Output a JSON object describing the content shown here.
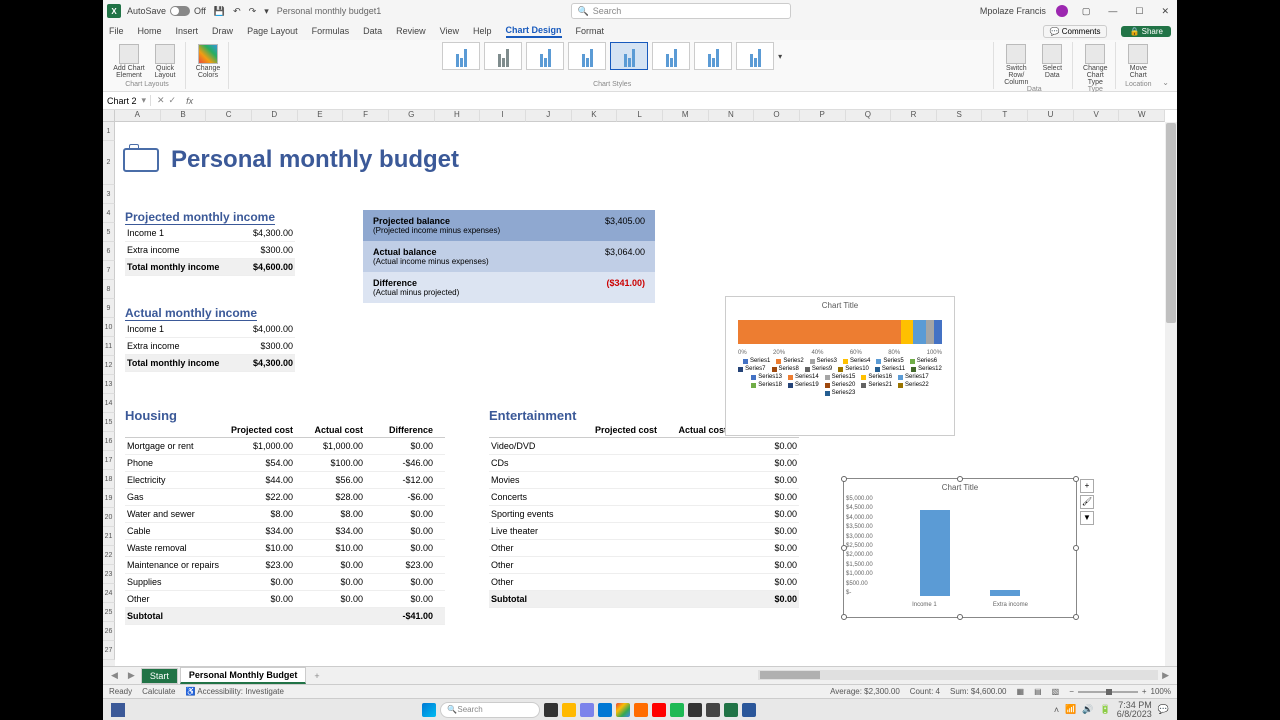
{
  "titlebar": {
    "autosave": "AutoSave",
    "autosave_state": "Off",
    "docname": "Personal monthly budget1",
    "search_placeholder": "Search",
    "username": "Mpolaze Francis"
  },
  "ribbon_tabs": [
    "File",
    "Home",
    "Insert",
    "Draw",
    "Page Layout",
    "Formulas",
    "Data",
    "Review",
    "View",
    "Help",
    "Chart Design",
    "Format"
  ],
  "ribbon_active": "Chart Design",
  "ribbon_right": {
    "comments": "Comments",
    "share": "Share"
  },
  "ribbon_groups": {
    "layouts": {
      "add_element": "Add Chart Element",
      "quick": "Quick Layout",
      "label": "Chart Layouts"
    },
    "colors": {
      "change": "Change Colors"
    },
    "styles_label": "Chart Styles",
    "data": {
      "switch": "Switch Row/ Column",
      "select": "Select Data",
      "label": "Data"
    },
    "type": {
      "change": "Change Chart Type",
      "label": "Type"
    },
    "location": {
      "move": "Move Chart",
      "label": "Location"
    }
  },
  "namebox": "Chart 2",
  "columns": [
    "A",
    "B",
    "C",
    "D",
    "E",
    "F",
    "G",
    "H",
    "I",
    "J",
    "K",
    "L",
    "M",
    "N",
    "O",
    "P",
    "Q",
    "R",
    "S",
    "T",
    "U",
    "V",
    "W"
  ],
  "rows": [
    "1",
    "2",
    "3",
    "4",
    "5",
    "6",
    "7",
    "8",
    "9",
    "10",
    "11",
    "12",
    "13",
    "14",
    "15",
    "16",
    "17",
    "18",
    "19",
    "20",
    "21",
    "22",
    "23",
    "24",
    "25",
    "26",
    "27"
  ],
  "doc": {
    "title": "Personal monthly budget",
    "proj_income_h": "Projected monthly income",
    "actual_income_h": "Actual monthly income",
    "income_rows": [
      {
        "label": "Income 1",
        "proj": "$4,300.00",
        "actual": "$4,000.00"
      },
      {
        "label": "Extra income",
        "proj": "$300.00",
        "actual": "$300.00"
      },
      {
        "label": "Total monthly income",
        "proj": "$4,600.00",
        "actual": "$4,300.00"
      }
    ],
    "balance": {
      "proj_label": "Projected balance",
      "proj_sub": "(Projected income minus expenses)",
      "proj_val": "$3,405.00",
      "actual_label": "Actual balance",
      "actual_sub": "(Actual income minus expenses)",
      "actual_val": "$3,064.00",
      "diff_label": "Difference",
      "diff_sub": "(Actual minus projected)",
      "diff_val": "($341.00)"
    },
    "housing_h": "Housing",
    "ent_h": "Entertainment",
    "col_headers": {
      "proj": "Projected cost",
      "actual": "Actual cost",
      "diff": "Difference"
    },
    "housing": [
      {
        "n": "Mortgage or rent",
        "p": "$1,000.00",
        "a": "$1,000.00",
        "d": "$0.00"
      },
      {
        "n": "Phone",
        "p": "$54.00",
        "a": "$100.00",
        "d": "-$46.00"
      },
      {
        "n": "Electricity",
        "p": "$44.00",
        "a": "$56.00",
        "d": "-$12.00"
      },
      {
        "n": "Gas",
        "p": "$22.00",
        "a": "$28.00",
        "d": "-$6.00"
      },
      {
        "n": "Water and sewer",
        "p": "$8.00",
        "a": "$8.00",
        "d": "$0.00"
      },
      {
        "n": "Cable",
        "p": "$34.00",
        "a": "$34.00",
        "d": "$0.00"
      },
      {
        "n": "Waste removal",
        "p": "$10.00",
        "a": "$10.00",
        "d": "$0.00"
      },
      {
        "n": "Maintenance or repairs",
        "p": "$23.00",
        "a": "$0.00",
        "d": "$23.00"
      },
      {
        "n": "Supplies",
        "p": "$0.00",
        "a": "$0.00",
        "d": "$0.00"
      },
      {
        "n": "Other",
        "p": "$0.00",
        "a": "$0.00",
        "d": "$0.00"
      }
    ],
    "housing_subtotal": {
      "n": "Subtotal",
      "d": "-$41.00"
    },
    "entertainment": [
      {
        "n": "Video/DVD",
        "d": "$0.00"
      },
      {
        "n": "CDs",
        "d": "$0.00"
      },
      {
        "n": "Movies",
        "d": "$0.00"
      },
      {
        "n": "Concerts",
        "d": "$0.00"
      },
      {
        "n": "Sporting events",
        "d": "$0.00"
      },
      {
        "n": "Live theater",
        "d": "$0.00"
      },
      {
        "n": "Other",
        "d": "$0.00"
      },
      {
        "n": "Other",
        "d": "$0.00"
      },
      {
        "n": "Other",
        "d": "$0.00"
      }
    ],
    "ent_subtotal": {
      "n": "Subtotal",
      "d": "$0.00"
    }
  },
  "chart1": {
    "title": "Chart Title",
    "xticks": [
      "0%",
      "20%",
      "40%",
      "60%",
      "80%",
      "100%"
    ],
    "legend": [
      "Series1",
      "Series2",
      "Series3",
      "Series4",
      "Series5",
      "Series6",
      "Series7",
      "Series8",
      "Series9",
      "Series10",
      "Series11",
      "Series12",
      "Series13",
      "Series14",
      "Series15",
      "Series16",
      "Series17",
      "Series18",
      "Series19",
      "Series20",
      "Series21",
      "Series22",
      "Series23"
    ]
  },
  "chart_data": {
    "type": "bar",
    "title": "Chart Title",
    "categories": [
      "Income 1",
      "Extra income"
    ],
    "values": [
      4300,
      300
    ],
    "yticks": [
      "$5,000.00",
      "$4,500.00",
      "$4,000.00",
      "$3,500.00",
      "$3,000.00",
      "$2,500.00",
      "$2,000.00",
      "$1,500.00",
      "$1,000.00",
      "$500.00",
      "$-"
    ],
    "ylim": [
      0,
      5000
    ]
  },
  "sheet_tabs": {
    "start": "Start",
    "active": "Personal Monthly Budget"
  },
  "statusbar": {
    "ready": "Ready",
    "calculate": "Calculate",
    "accessibility": "Accessibility: Investigate",
    "average": "Average: $2,300.00",
    "count": "Count: 4",
    "sum": "Sum: $4,600.00",
    "zoom": "100%"
  },
  "taskbar": {
    "search": "Search",
    "time": "7:34 PM",
    "date": "6/8/2023"
  }
}
